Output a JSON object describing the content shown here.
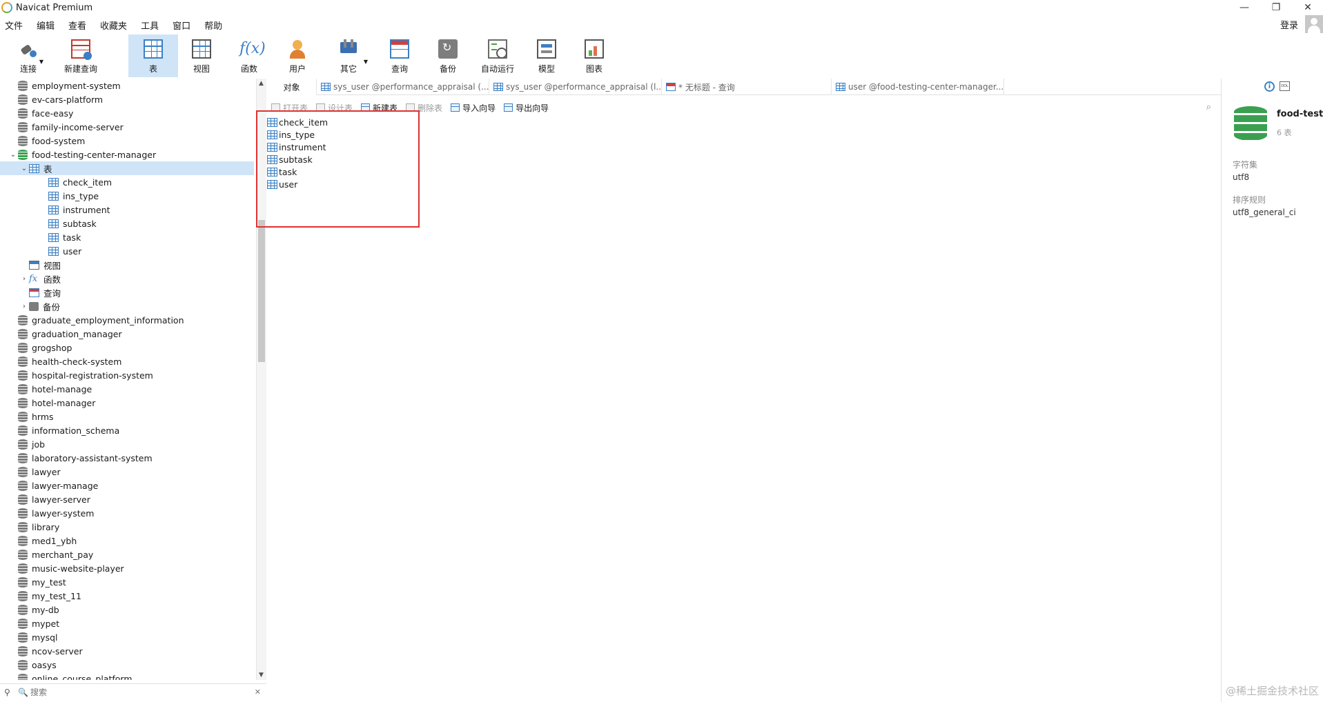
{
  "window": {
    "title": "Navicat Premium",
    "min": "—",
    "restore": "❐",
    "close": "✕"
  },
  "menu": [
    "文件",
    "编辑",
    "查看",
    "收藏夹",
    "工具",
    "窗口",
    "帮助"
  ],
  "login_label": "登录",
  "toolbar": [
    {
      "label": "连接",
      "icon": "plug-icon",
      "dropdown": true
    },
    {
      "label": "新建查询",
      "icon": "new-query-icon"
    },
    {
      "label": "表",
      "icon": "table-icon",
      "active": true
    },
    {
      "label": "视图",
      "icon": "view-icon"
    },
    {
      "label": "函数",
      "icon": "function-icon"
    },
    {
      "label": "用户",
      "icon": "user-icon"
    },
    {
      "label": "其它",
      "icon": "tools-icon",
      "dropdown": true
    },
    {
      "label": "查询",
      "icon": "query-icon"
    },
    {
      "label": "备份",
      "icon": "backup-icon"
    },
    {
      "label": "自动运行",
      "icon": "automation-icon"
    },
    {
      "label": "模型",
      "icon": "model-icon"
    },
    {
      "label": "图表",
      "icon": "chart-icon"
    }
  ],
  "tree": [
    {
      "label": "employment-system",
      "type": "db"
    },
    {
      "label": "ev-cars-platform",
      "type": "db"
    },
    {
      "label": "face-easy",
      "type": "db"
    },
    {
      "label": "family-income-server",
      "type": "db"
    },
    {
      "label": "food-system",
      "type": "db"
    },
    {
      "label": "food-testing-center-manager",
      "type": "db-open",
      "expanded": true
    },
    {
      "label": "表",
      "type": "tables-folder",
      "expanded": true,
      "selected": true
    },
    {
      "label": "check_item",
      "type": "table"
    },
    {
      "label": "ins_type",
      "type": "table"
    },
    {
      "label": "instrument",
      "type": "table"
    },
    {
      "label": "subtask",
      "type": "table"
    },
    {
      "label": "task",
      "type": "table"
    },
    {
      "label": "user",
      "type": "table"
    },
    {
      "label": "视图",
      "type": "views-folder"
    },
    {
      "label": "函数",
      "type": "functions-folder",
      "collapsed": true
    },
    {
      "label": "查询",
      "type": "queries-folder"
    },
    {
      "label": "备份",
      "type": "backups-folder",
      "collapsed": true
    },
    {
      "label": "graduate_employment_information",
      "type": "db"
    },
    {
      "label": "graduation_manager",
      "type": "db"
    },
    {
      "label": "grogshop",
      "type": "db"
    },
    {
      "label": "health-check-system",
      "type": "db"
    },
    {
      "label": "hospital-registration-system",
      "type": "db"
    },
    {
      "label": "hotel-manage",
      "type": "db"
    },
    {
      "label": "hotel-manager",
      "type": "db"
    },
    {
      "label": "hrms",
      "type": "db"
    },
    {
      "label": "information_schema",
      "type": "db"
    },
    {
      "label": "job",
      "type": "db"
    },
    {
      "label": "laboratory-assistant-system",
      "type": "db"
    },
    {
      "label": "lawyer",
      "type": "db"
    },
    {
      "label": "lawyer-manage",
      "type": "db"
    },
    {
      "label": "lawyer-server",
      "type": "db"
    },
    {
      "label": "lawyer-system",
      "type": "db"
    },
    {
      "label": "library",
      "type": "db"
    },
    {
      "label": "med1_ybh",
      "type": "db"
    },
    {
      "label": "merchant_pay",
      "type": "db"
    },
    {
      "label": "music-website-player",
      "type": "db"
    },
    {
      "label": "my_test",
      "type": "db"
    },
    {
      "label": "my_test_11",
      "type": "db"
    },
    {
      "label": "my-db",
      "type": "db"
    },
    {
      "label": "mypet",
      "type": "db"
    },
    {
      "label": "mysql",
      "type": "db"
    },
    {
      "label": "ncov-server",
      "type": "db"
    },
    {
      "label": "oasys",
      "type": "db"
    },
    {
      "label": "online_course_platform",
      "type": "db"
    }
  ],
  "search": {
    "placeholder": "搜索"
  },
  "tabs": [
    {
      "label": "对象",
      "active": true
    },
    {
      "label": "sys_user @performance_appraisal (...",
      "icon": "table"
    },
    {
      "label": "sys_user @performance_appraisal (l...",
      "icon": "table"
    },
    {
      "label": "* 无标题 - 查询",
      "icon": "query"
    },
    {
      "label": "user @food-testing-center-manager...",
      "icon": "table"
    }
  ],
  "object_toolbar": [
    {
      "label": "打开表",
      "disabled": true
    },
    {
      "label": "设计表",
      "disabled": true
    },
    {
      "label": "新建表",
      "disabled": false
    },
    {
      "label": "删除表",
      "disabled": true
    },
    {
      "label": "导入向导",
      "disabled": false
    },
    {
      "label": "导出向导",
      "disabled": false
    }
  ],
  "objects": [
    "check_item",
    "ins_type",
    "instrument",
    "subtask",
    "task",
    "user"
  ],
  "info": {
    "db_name": "food-test",
    "table_count": "6 表",
    "charset_label": "字符集",
    "charset_value": "utf8",
    "collation_label": "排序规则",
    "collation_value": "utf8_general_ci"
  },
  "watermark": "@稀土掘金技术社区"
}
